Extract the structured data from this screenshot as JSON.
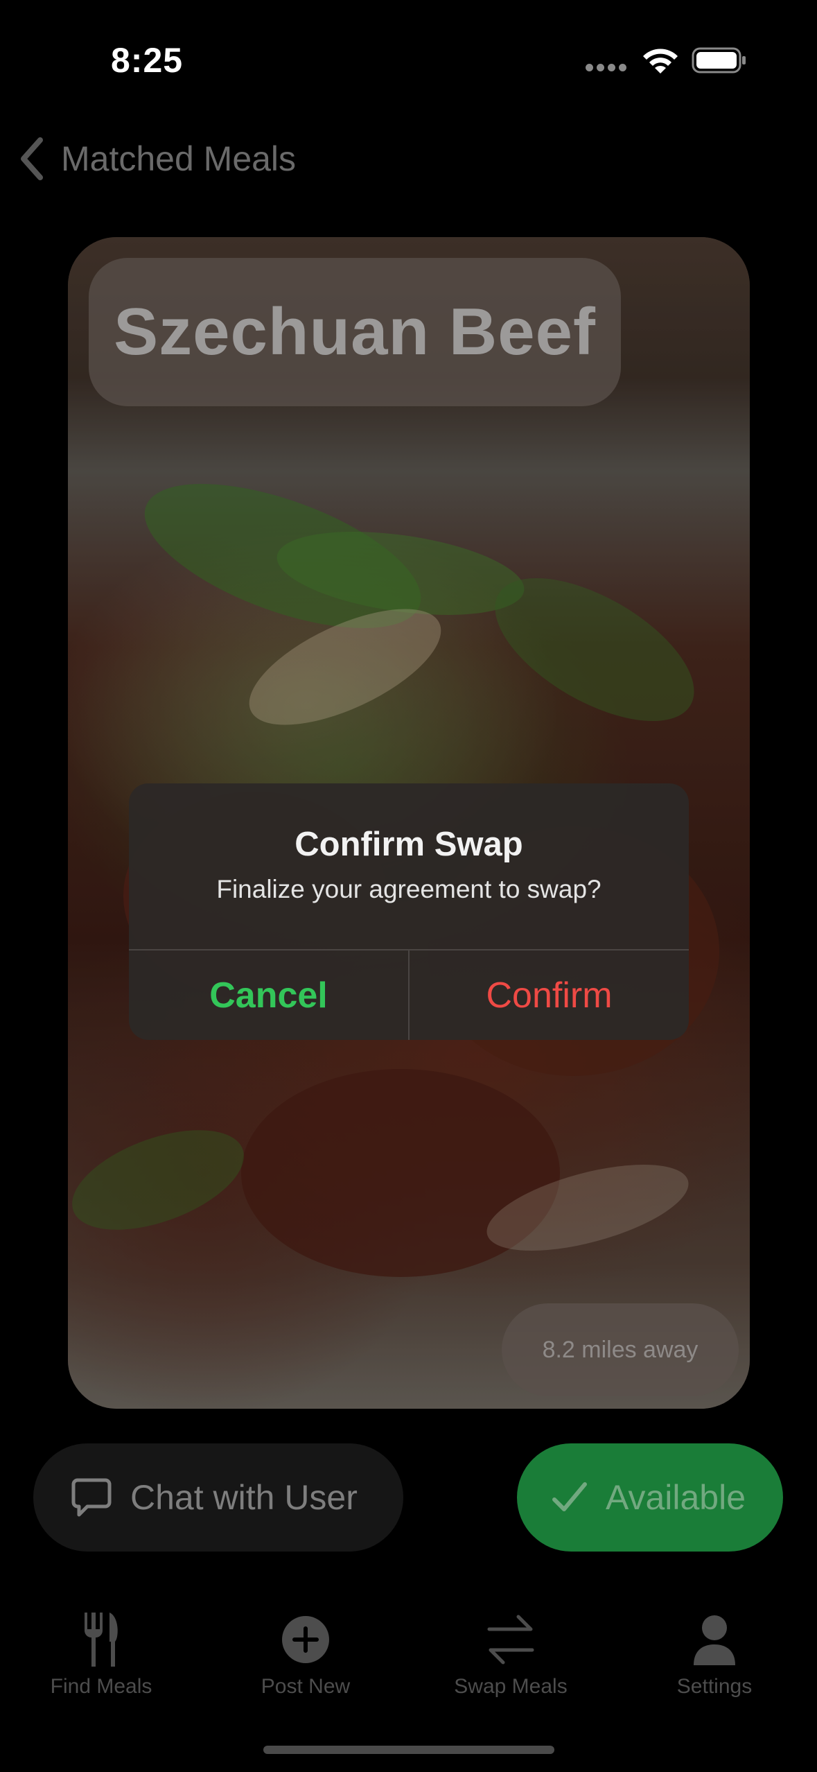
{
  "status_bar": {
    "time": "8:25",
    "icons": [
      "cellular-signal-icon",
      "wifi-icon",
      "battery-icon"
    ]
  },
  "nav": {
    "back_label": "Matched Meals",
    "icon": "chevron-left-icon"
  },
  "meal": {
    "title": "Szechuan Beef",
    "distance": "8.2 miles away"
  },
  "actions": {
    "chat_label": "Chat with User",
    "chat_icon": "chat-bubble-icon",
    "available_label": "Available",
    "available_icon": "checkmark-icon",
    "available_color": "#1a7d38"
  },
  "tab_bar": {
    "items": [
      {
        "label": "Find Meals",
        "icon": "fork-knife-icon"
      },
      {
        "label": "Post New",
        "icon": "plus-circle-icon"
      },
      {
        "label": "Swap Meals",
        "icon": "swap-arrows-icon"
      },
      {
        "label": "Settings",
        "icon": "person-icon"
      }
    ]
  },
  "alert": {
    "title": "Confirm Swap",
    "message": "Finalize your agreement to swap?",
    "cancel_label": "Cancel",
    "confirm_label": "Confirm",
    "cancel_color": "#33c659",
    "confirm_color": "#ef4a45"
  }
}
